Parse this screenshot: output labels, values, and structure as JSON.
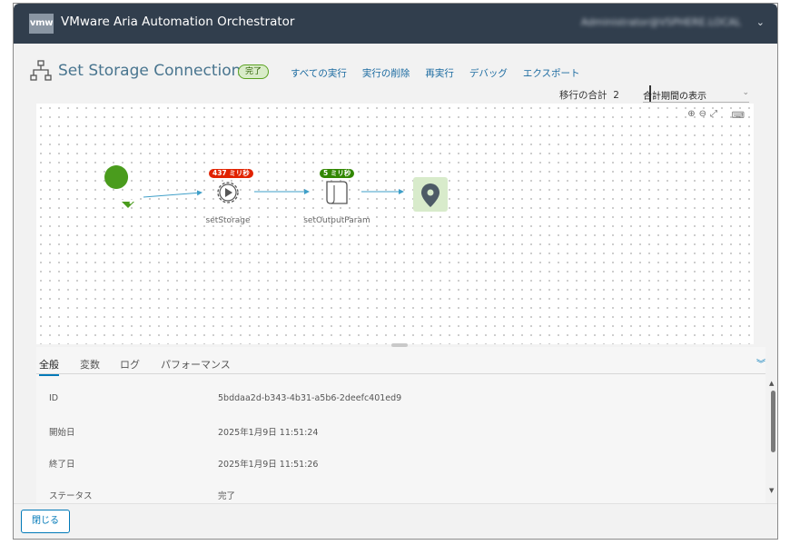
{
  "app": {
    "logo_text": "vmw",
    "title": "VMware Aria Automation Orchestrator",
    "user": "Administrator@VSPHERE.LOCAL",
    "user_caret": "⌄"
  },
  "workflow": {
    "title": "Set Storage Connection",
    "status_badge": "完了",
    "actions": [
      "すべての実行",
      "実行の削除",
      "再実行",
      "デバッグ",
      "エクスポート"
    ],
    "total_label": "移行の合計",
    "total_value": "2",
    "period_select": "合計期間の表示"
  },
  "canvas": {
    "tools": "⊕⊖⤢",
    "keyboard_icon": "⌨",
    "nodes": [
      {
        "name": "start",
        "label": ""
      },
      {
        "name": "setStorage",
        "label": "setStorage",
        "time": "437 ミリ秒",
        "time_color": "#e12200"
      },
      {
        "name": "setOutputParam",
        "label": "setOutputParam",
        "time": "5 ミリ秒",
        "time_color": "#318700"
      },
      {
        "name": "end",
        "label": ""
      }
    ]
  },
  "details": {
    "tabs": [
      "全般",
      "変数",
      "ログ",
      "パフォーマンス"
    ],
    "active_tab": "全般",
    "expand_icon": "︾",
    "rows": [
      {
        "key": "ID",
        "value": "5bddaa2d-b343-4b31-a5b6-2deefc401ed9"
      },
      {
        "key": "開始日",
        "value": "2025年1月9日 11:51:24"
      },
      {
        "key": "終了日",
        "value": "2025年1月9日 11:51:26"
      },
      {
        "key": "ステータス",
        "value": "完了"
      }
    ]
  },
  "footer": {
    "close_label": "閉じる"
  }
}
